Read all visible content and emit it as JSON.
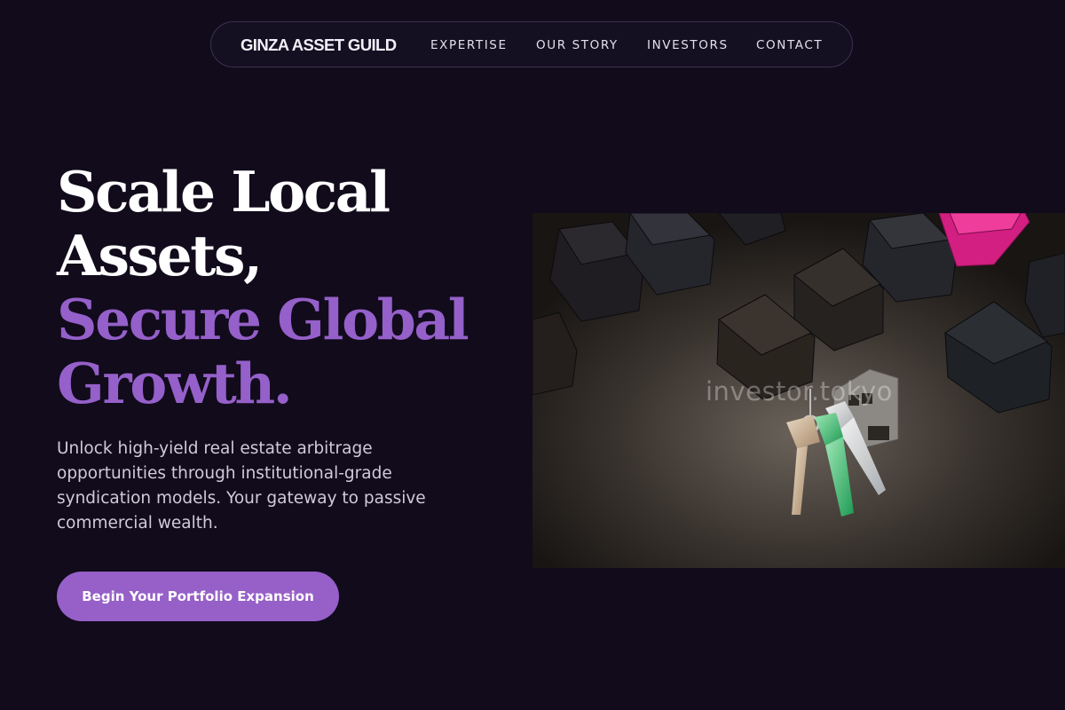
{
  "nav": {
    "brand": "GINZA ASSET GUILD",
    "links": [
      "EXPERTISE",
      "OUR STORY",
      "INVESTORS",
      "CONTACT"
    ]
  },
  "hero": {
    "headline_white": [
      "Scale Local",
      "Assets,"
    ],
    "headline_accent": [
      "Secure Global",
      "Growth."
    ],
    "subtext": "Unlock high-yield real estate arbitrage opportunities through institutional-grade syndication models. Your gateway to passive commercial wealth.",
    "cta_label": "Begin Your Portfolio Expansion",
    "image_watermark": "investor.tokyo"
  },
  "colors": {
    "background": "#110b1c",
    "accent": "#9560c9",
    "button": "#9660c8"
  },
  "icons": {
    "image_subject": "model-houses-and-keys"
  }
}
